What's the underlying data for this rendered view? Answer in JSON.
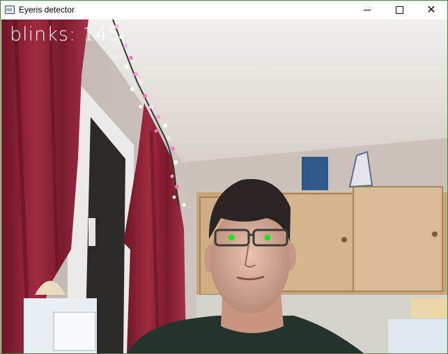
{
  "window": {
    "title": "Eyeris detector",
    "icon": "app-window-icon",
    "controls": {
      "minimize": "minimize-icon",
      "maximize": "maximize-icon",
      "close": "close-icon",
      "close_glyph": "✕"
    }
  },
  "overlay": {
    "label": "blinks:",
    "count": "145"
  },
  "markers": {
    "color": "#22e022",
    "eyes": [
      "left-eye-marker",
      "right-eye-marker"
    ]
  },
  "colors": {
    "border": "#3c8a3c",
    "curtain": "#8c1f32",
    "wall": "#cfc7c0",
    "cabinet": "#c8a57a"
  }
}
